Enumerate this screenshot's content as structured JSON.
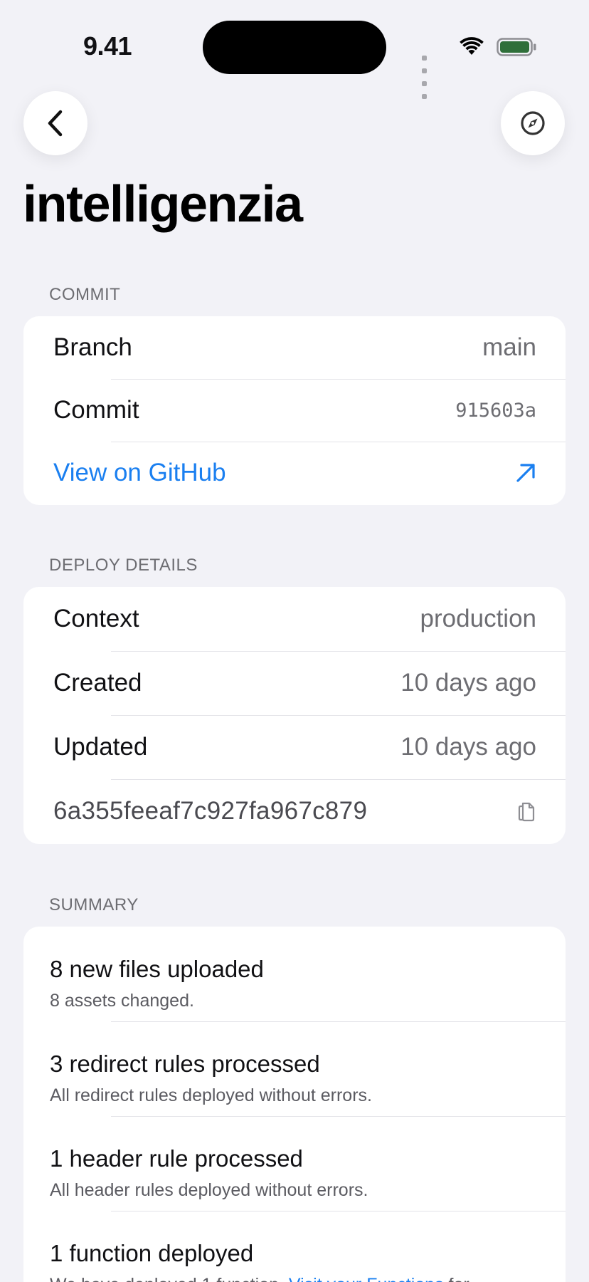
{
  "status_bar": {
    "time": "9.41",
    "icons": [
      "signal-dots-icon",
      "wifi-icon",
      "battery-icon"
    ],
    "battery_color": "#2f6f3a"
  },
  "nav": {
    "back_icon": "chevron-left-icon",
    "compass_icon": "compass-icon"
  },
  "title": "intelligenzia",
  "commit_section": {
    "header": "COMMIT",
    "branch_label": "Branch",
    "branch_value": "main",
    "commit_label": "Commit",
    "commit_value": "915603a",
    "github_link": "View on GitHub",
    "github_icon": "arrow-up-right-icon"
  },
  "deploy_section": {
    "header": "DEPLOY DETAILS",
    "context_label": "Context",
    "context_value": "production",
    "created_label": "Created",
    "created_value": "10 days ago",
    "updated_label": "Updated",
    "updated_value": "10 days ago",
    "deploy_id": "6a355feeaf7c927fa967c879",
    "copy_icon": "copy-icon"
  },
  "summary_section": {
    "header": "SUMMARY",
    "items": [
      {
        "title": "8 new files uploaded",
        "description": "8 assets changed."
      },
      {
        "title": "3 redirect rules processed",
        "description": "All redirect rules deployed without errors."
      },
      {
        "title": "1 header rule processed",
        "description": "All header rules deployed without errors."
      },
      {
        "title": "1 function deployed",
        "description": "We have deployed 1 function.",
        "link": "Visit your Functions",
        "description_tail": "for"
      }
    ]
  },
  "colors": {
    "accent": "#1a7ff0",
    "background": "#f2f2f7",
    "card": "#ffffff",
    "secondary_text": "#6d6d72"
  }
}
